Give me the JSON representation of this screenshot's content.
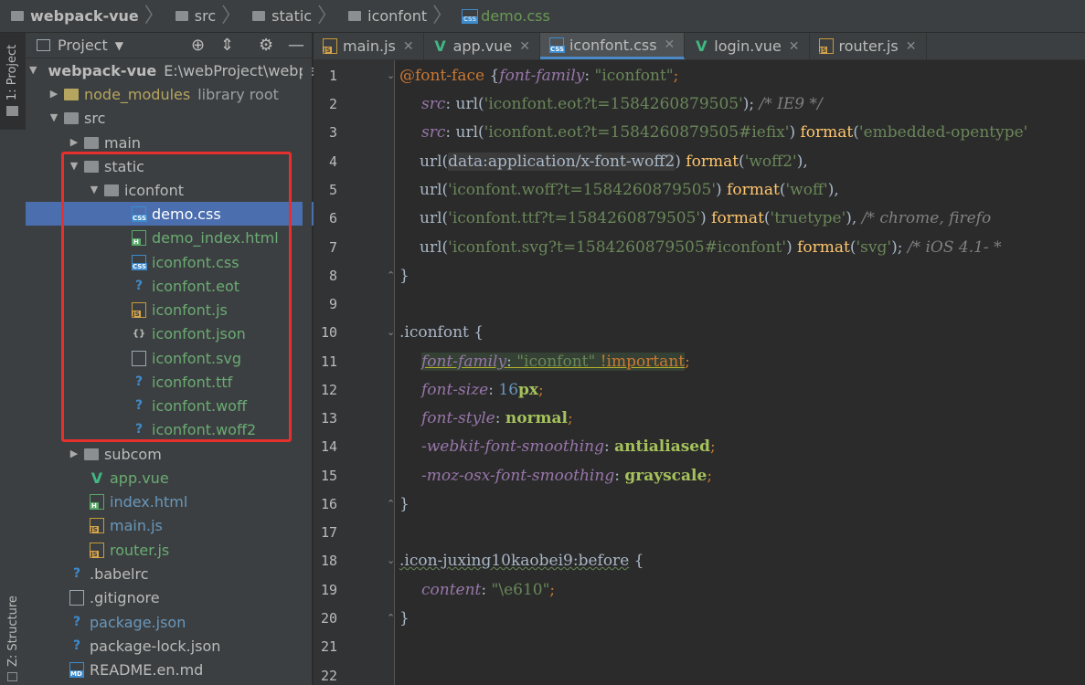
{
  "breadcrumb": {
    "items": [
      "webpack-vue",
      "src",
      "static",
      "iconfont",
      "demo.css"
    ]
  },
  "sidebar_strip": {
    "project_tab": "1: Project",
    "structure_tab": "Z: Structure"
  },
  "panel": {
    "title": "Project",
    "tree": [
      {
        "label": "webpack-vue",
        "extra": "E:\\webProject\\webpa"
      },
      {
        "label": "node_modules",
        "extra": "library root"
      },
      {
        "label": "src"
      },
      {
        "label": "main"
      },
      {
        "label": "static"
      },
      {
        "label": "iconfont"
      },
      {
        "label": "demo.css"
      },
      {
        "label": "demo_index.html"
      },
      {
        "label": "iconfont.css"
      },
      {
        "label": "iconfont.eot"
      },
      {
        "label": "iconfont.js"
      },
      {
        "label": "iconfont.json"
      },
      {
        "label": "iconfont.svg"
      },
      {
        "label": "iconfont.ttf"
      },
      {
        "label": "iconfont.woff"
      },
      {
        "label": "iconfont.woff2"
      },
      {
        "label": "subcom"
      },
      {
        "label": "app.vue"
      },
      {
        "label": "index.html"
      },
      {
        "label": "main.js"
      },
      {
        "label": "router.js"
      },
      {
        "label": ".babelrc"
      },
      {
        "label": ".gitignore"
      },
      {
        "label": "package.json"
      },
      {
        "label": "package-lock.json"
      },
      {
        "label": "README.en.md"
      }
    ]
  },
  "tabs": [
    "main.js",
    "app.vue",
    "iconfont.css",
    "login.vue",
    "router.js"
  ],
  "editor": {
    "lines": [
      {
        "n": "1"
      },
      {
        "n": "2"
      },
      {
        "n": "3"
      },
      {
        "n": "4"
      },
      {
        "n": "5"
      },
      {
        "n": "6"
      },
      {
        "n": "7"
      },
      {
        "n": "8"
      },
      {
        "n": "9"
      },
      {
        "n": "10"
      },
      {
        "n": "11"
      },
      {
        "n": "12"
      },
      {
        "n": "13"
      },
      {
        "n": "14"
      },
      {
        "n": "15"
      },
      {
        "n": "16"
      },
      {
        "n": "17"
      },
      {
        "n": "18"
      },
      {
        "n": "19"
      },
      {
        "n": "20"
      },
      {
        "n": "21"
      },
      {
        "n": "22"
      }
    ],
    "code": {
      "l1a": "@font-face",
      "l1b": " {",
      "l1c": "font-family",
      "l1d": ": ",
      "l1e": "\"iconfont\"",
      "l1f": ";",
      "l2a": "src",
      "l2b": ": url(",
      "l2c": "'iconfont.eot?t=1584260879505'",
      "l2d": "); ",
      "l2e": "/* IE9 */",
      "l3a": "src",
      "l3b": ": url(",
      "l3c": "'iconfont.eot?t=1584260879505#iefix'",
      "l3d": ") ",
      "l3e": "format",
      "l3f": "(",
      "l3g": "'embedded-opentype'",
      "l4a": "url(",
      "l4b": "data:application/x-font-woff2",
      "l4c": ") ",
      "l4d": "format",
      "l4e": "(",
      "l4f": "'woff2'",
      "l4g": "),",
      "l5a": "url(",
      "l5b": "'iconfont.woff?t=1584260879505'",
      "l5c": ") ",
      "l5d": "format",
      "l5e": "(",
      "l5f": "'woff'",
      "l5g": "),",
      "l6a": "url(",
      "l6b": "'iconfont.ttf?t=1584260879505'",
      "l6c": ") ",
      "l6d": "format",
      "l6e": "(",
      "l6f": "'truetype'",
      "l6g": "), ",
      "l6h": "/* chrome, firefo",
      "l7a": "url(",
      "l7b": "'iconfont.svg?t=1584260879505#iconfont'",
      "l7c": ") ",
      "l7d": "format",
      "l7e": "(",
      "l7f": "'svg'",
      "l7g": "); ",
      "l7h": "/* iOS 4.1- *",
      "l8a": "}",
      "l10a": ".iconfont",
      "l10b": " {",
      "l11a": "font-family",
      "l11b": ": ",
      "l11c": "\"iconfont\"",
      "l11d": " !important",
      "l11e": ";",
      "l12a": "font-size",
      "l12b": ": ",
      "l12c": "16",
      "l12d": "px",
      "l12e": ";",
      "l13a": "font-style",
      "l13b": ": ",
      "l13c": "normal",
      "l13d": ";",
      "l14a": "-webkit-font-smoothing",
      "l14b": ": ",
      "l14c": "antialiased",
      "l14d": ";",
      "l15a": "-moz-osx-font-smoothing",
      "l15b": ": ",
      "l15c": "grayscale",
      "l15d": ";",
      "l16a": "}",
      "l18a": ".icon-juxing10kaobei9:before",
      "l18b": " {",
      "l19a": "content",
      "l19b": ": ",
      "l19c": "\"\\e610\"",
      "l19d": ";",
      "l20a": "}"
    }
  },
  "colors": {
    "selection": "#4b6eaf",
    "highlight_box": "#e5302e",
    "active_tab_underline": "#4a88c7"
  }
}
